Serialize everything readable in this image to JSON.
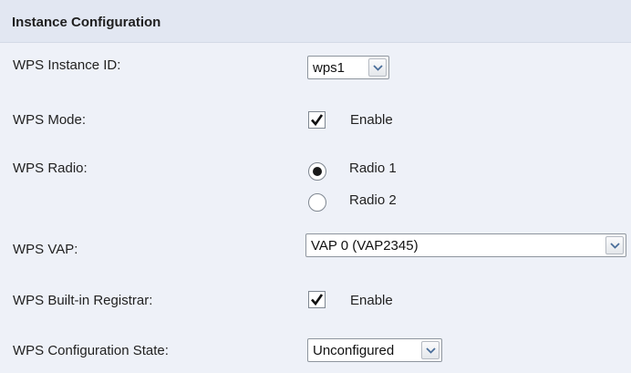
{
  "section": {
    "title": "Instance Configuration"
  },
  "instance_id": {
    "label": "WPS Instance ID:",
    "selected": "wps1",
    "icon": "chevron-down-icon"
  },
  "mode": {
    "label": "WPS Mode:",
    "checked": true,
    "option_label": "Enable"
  },
  "radio": {
    "label": "WPS Radio:",
    "options": [
      {
        "label": "Radio 1",
        "selected": true
      },
      {
        "label": "Radio 2",
        "selected": false
      }
    ]
  },
  "vap": {
    "label": "WPS VAP:",
    "selected": "VAP 0 (VAP2345)",
    "icon": "chevron-down-icon"
  },
  "registrar": {
    "label": "WPS Built-in Registrar:",
    "checked": true,
    "option_label": "Enable"
  },
  "config_state": {
    "label": "WPS Configuration State:",
    "selected": "Unconfigured",
    "icon": "chevron-down-icon"
  }
}
